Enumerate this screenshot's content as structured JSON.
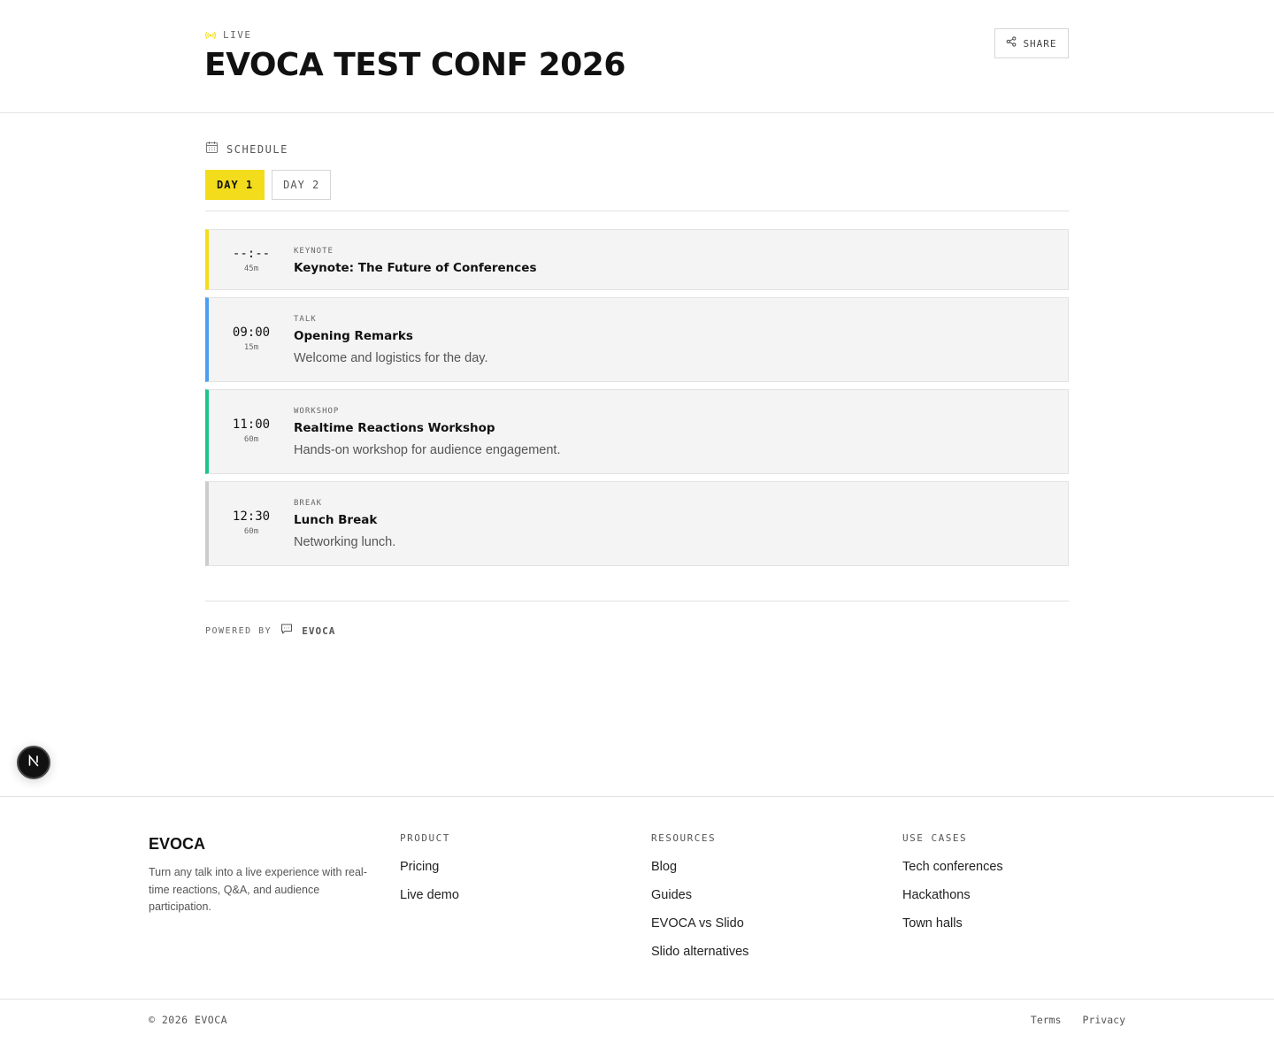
{
  "header": {
    "live_label": "LIVE",
    "event_title": "EVOCA TEST CONF 2026",
    "share_label": "SHARE"
  },
  "colors": {
    "accent": "#f2dc1c",
    "keynote": "#f2dc1c",
    "talk": "#4a9ff0",
    "workshop": "#1dc48a",
    "break": "#cccccc"
  },
  "schedule": {
    "label": "SCHEDULE",
    "tabs": [
      {
        "label": "DAY 1",
        "active": true
      },
      {
        "label": "DAY 2",
        "active": false
      }
    ],
    "sessions": [
      {
        "time": "--:--",
        "duration": "45m",
        "type": "KEYNOTE",
        "title": "Keynote: The Future of Conferences",
        "description": ""
      },
      {
        "time": "09:00",
        "duration": "15m",
        "type": "TALK",
        "title": "Opening Remarks",
        "description": "Welcome and logistics for the day."
      },
      {
        "time": "11:00",
        "duration": "60m",
        "type": "WORKSHOP",
        "title": "Realtime Reactions Workshop",
        "description": "Hands-on workshop for audience engagement."
      },
      {
        "time": "12:30",
        "duration": "60m",
        "type": "BREAK",
        "title": "Lunch Break",
        "description": "Networking lunch."
      }
    ]
  },
  "powered": {
    "label": "POWERED BY",
    "brand": "EVOCA"
  },
  "footer": {
    "brand": "EVOCA",
    "tagline": "Turn any talk into a live experience with real-time reactions, Q&A, and audience participation.",
    "product": {
      "heading": "PRODUCT",
      "links": [
        "Pricing",
        "Live demo"
      ]
    },
    "resources": {
      "heading": "RESOURCES",
      "links": [
        "Blog",
        "Guides",
        "EVOCA vs Slido",
        "Slido alternatives"
      ]
    },
    "use_cases": {
      "heading": "USE CASES",
      "links": [
        "Tech conferences",
        "Hackathons",
        "Town halls"
      ]
    },
    "copyright": "© 2026 EVOCA",
    "terms": "Terms",
    "privacy": "Privacy"
  },
  "dev_badge": {
    "letter": "N"
  }
}
